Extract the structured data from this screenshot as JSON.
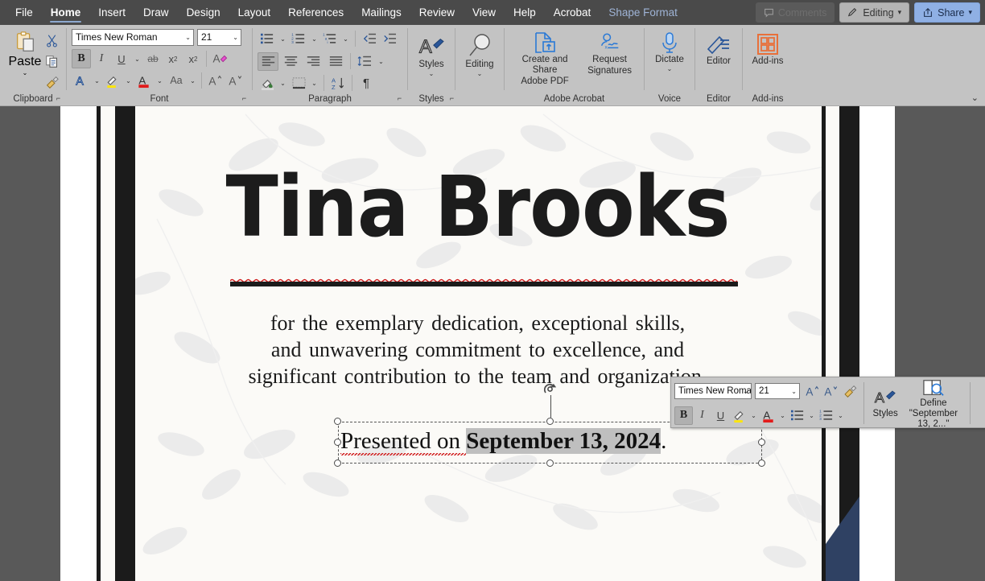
{
  "app": {
    "menu_items": [
      {
        "label": "File",
        "active": false,
        "contextual": false
      },
      {
        "label": "Home",
        "active": true,
        "contextual": false
      },
      {
        "label": "Insert",
        "active": false,
        "contextual": false
      },
      {
        "label": "Draw",
        "active": false,
        "contextual": false
      },
      {
        "label": "Design",
        "active": false,
        "contextual": false
      },
      {
        "label": "Layout",
        "active": false,
        "contextual": false
      },
      {
        "label": "References",
        "active": false,
        "contextual": false
      },
      {
        "label": "Mailings",
        "active": false,
        "contextual": false
      },
      {
        "label": "Review",
        "active": false,
        "contextual": false
      },
      {
        "label": "View",
        "active": false,
        "contextual": false
      },
      {
        "label": "Help",
        "active": false,
        "contextual": false
      },
      {
        "label": "Acrobat",
        "active": false,
        "contextual": false
      },
      {
        "label": "Shape Format",
        "active": false,
        "contextual": true
      }
    ],
    "comments_label": "Comments",
    "editing_label": "Editing",
    "share_label": "Share",
    "accent_blue": "#8fb0e4",
    "titlebar_bg": "#4a4a4a",
    "ribbon_bg": "#c3c3c3"
  },
  "ribbon": {
    "groups": [
      {
        "label": "Clipboard",
        "has_dialog": true
      },
      {
        "label": "Font",
        "has_dialog": true
      },
      {
        "label": "Paragraph",
        "has_dialog": true
      },
      {
        "label": "Styles",
        "has_dialog": true
      },
      {
        "label": "Adobe Acrobat",
        "has_dialog": false
      },
      {
        "label": "Voice",
        "has_dialog": false
      },
      {
        "label": "Editor",
        "has_dialog": false
      },
      {
        "label": "Add-ins",
        "has_dialog": false
      }
    ],
    "clipboard": {
      "paste_label": "Paste",
      "cut_name": "cut-icon",
      "copy_name": "copy-icon",
      "format_painter_name": "format-painter-icon"
    },
    "font": {
      "font_name_value": "Times New Roman",
      "font_size_value": "21",
      "bold_label": "B",
      "italic_label": "I",
      "underline_label": "U",
      "strikethrough_label": "ab",
      "subscript_label": "x",
      "superscript_label": "x",
      "clear_formatting_label": "A",
      "text_effects_label": "A",
      "highlight_label": "A",
      "font_color_label": "A",
      "change_case_label": "Aa",
      "grow_font_label": "A",
      "shrink_font_label": "A"
    },
    "styles": {
      "label": "Styles"
    },
    "acrobat": {
      "create_share_label": "Create and Share\nAdobe PDF",
      "create_share_line1": "Create and Share",
      "create_share_line2": "Adobe PDF",
      "request_line1": "Request",
      "request_line2": "Signatures"
    },
    "voice": {
      "dictate_label": "Dictate"
    },
    "editor_group": {
      "editor_label": "Editor"
    },
    "addins": {
      "addins_label": "Add-ins"
    },
    "editing_mode_label": "Editing",
    "collapse_ribbon_name": "collapse-ribbon-chevron"
  },
  "document": {
    "title": "Tina Brooks",
    "body_lines": [
      "for the exemplary  dedication,  exceptional  skills,",
      "and unwavering  commitment  to excellence,  and",
      "significant  contribution  to the team and organization."
    ],
    "textbox": {
      "prefix": "Presented on ",
      "selected": "September 13, 2024",
      "suffix": "."
    },
    "page_bg": "#fbfaf7",
    "canvas_bg": "#595959",
    "accent_navy": "#2f4163",
    "rule_color": "#1b1b1b"
  },
  "mini_toolbar": {
    "font_name_value": "Times New Roman",
    "font_size_value": "21",
    "bold_label": "B",
    "italic_label": "I",
    "underline_label": "U",
    "grow_font_label": "A",
    "shrink_font_label": "A",
    "styles_label": "Styles",
    "define_line1": "Define \"September",
    "define_line2": "13, 2...\""
  }
}
